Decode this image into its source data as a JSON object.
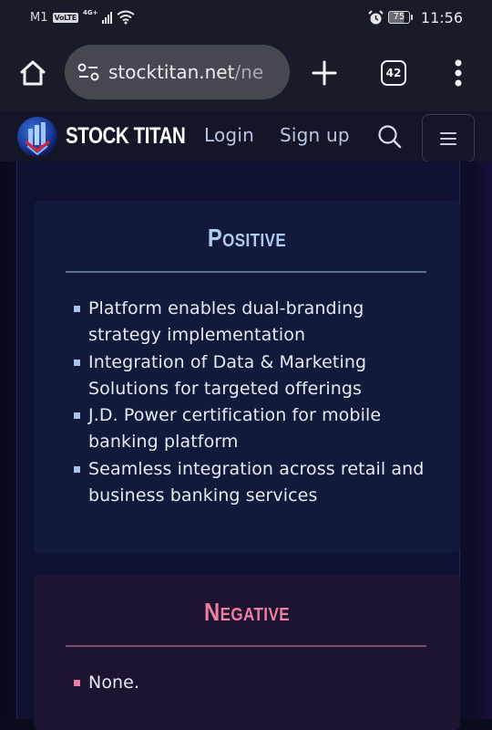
{
  "status_bar": {
    "carrier": "M1",
    "volte_badge": "VoLTE",
    "network_type": "4G+",
    "battery_level": "75",
    "time": "11:56",
    "icons": [
      "signal-icon",
      "wifi-icon",
      "alarm-icon",
      "battery-icon"
    ]
  },
  "browser": {
    "url_host": "stocktitan.net",
    "url_path": "/ne",
    "tab_count": "42",
    "icons": [
      "home-icon",
      "site-settings-icon",
      "new-tab-icon",
      "tab-switcher-icon",
      "more-menu-icon"
    ]
  },
  "site_header": {
    "logo_text": "STOCK TITAN",
    "nav": {
      "login": "Login",
      "signup": "Sign up"
    },
    "icons": [
      "search-icon",
      "hamburger-menu-icon"
    ]
  },
  "sentiment": {
    "positive": {
      "title": "Positive",
      "accent_color": "#aecbf0",
      "items": [
        "Platform enables dual-branding strategy implementation",
        "Integration of Data & Marketing Solutions for targeted offerings",
        "J.D. Power certification for mobile banking platform",
        "Seamless integration across retail and business banking services"
      ]
    },
    "negative": {
      "title": "Negative",
      "accent_color": "#ee7fa1",
      "items": [
        "None."
      ]
    }
  }
}
